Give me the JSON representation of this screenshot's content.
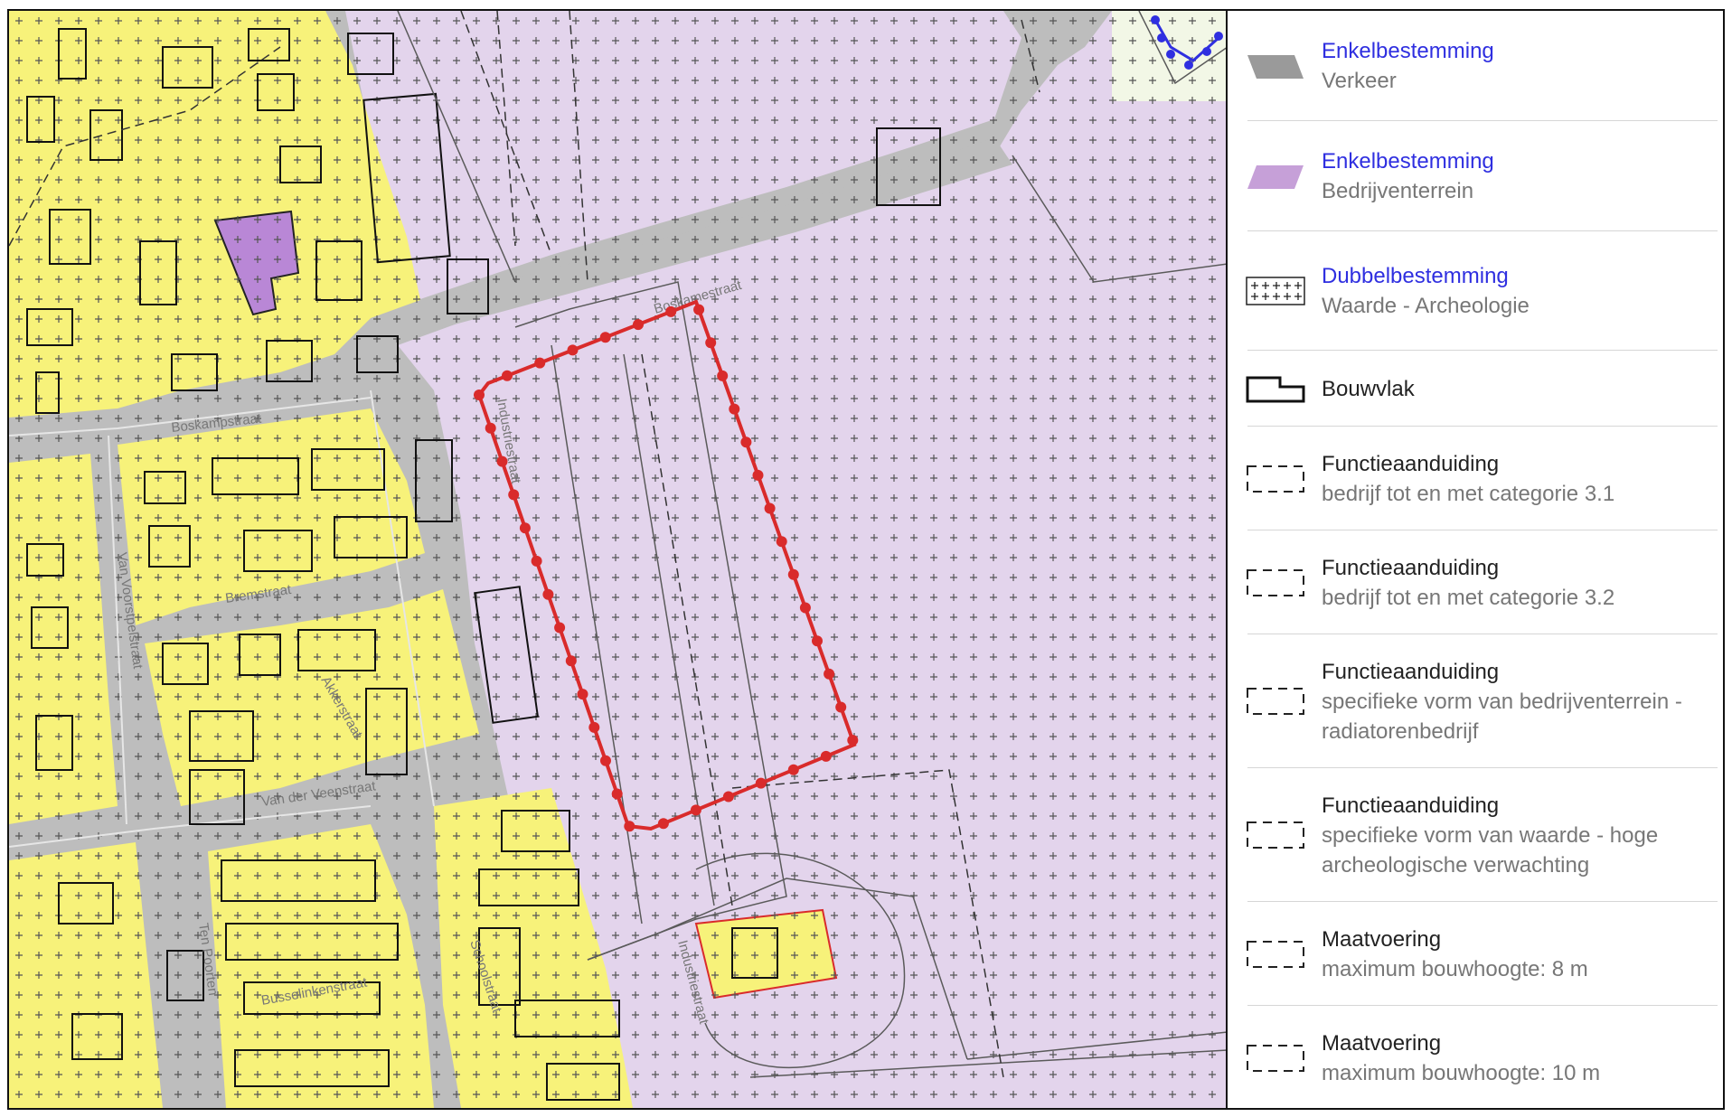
{
  "colors": {
    "verkeer": "#bdbdbd",
    "bedrijventerrein": "#e3d4ec",
    "bedrijventerrein_legend": "#c6a0d8",
    "wonen": "#f7f27a",
    "maatschappelijk": "#b987d6",
    "plangebied": "#d92b2b",
    "bouwvlak": "#111111",
    "kavel_lijn": "#5a5a5a"
  },
  "map": {
    "streets": [
      "Boskamestraat",
      "Boskampstraat",
      "Industriestraat",
      "Van Voorstpelstraat",
      "Bremstraat",
      "Akkerstraat",
      "Van der Veenstraat",
      "Ten Poorten",
      "Busselinkenstraat",
      "Schoolstraat",
      "Industriestraat"
    ]
  },
  "legend": {
    "items": [
      {
        "title": "Enkelbestemming",
        "sub": "Verkeer",
        "symbol": "fill-verkeer-icon",
        "title_color": "blue"
      },
      {
        "title": "Enkelbestemming",
        "sub": "Bedrijventerrein",
        "symbol": "fill-bedrijventerrein-icon",
        "title_color": "blue"
      },
      {
        "title": "Dubbelbestemming",
        "sub": "Waarde - Archeologie",
        "symbol": "crosshatch-icon",
        "title_color": "blue"
      },
      {
        "title": "Bouwvlak",
        "sub": "",
        "symbol": "bouwvlak-icon",
        "title_color": "plain"
      },
      {
        "title": "Functieaanduiding",
        "sub": "bedrijf tot en met categorie 3.1",
        "symbol": "dashed-rect-icon",
        "title_color": "plain"
      },
      {
        "title": "Functieaanduiding",
        "sub": "bedrijf tot en met categorie 3.2",
        "symbol": "dashed-rect-icon",
        "title_color": "plain"
      },
      {
        "title": "Functieaanduiding",
        "sub": "specifieke vorm van bedrijventerrein - radiatorenbedrijf",
        "symbol": "dashed-rect-icon",
        "title_color": "plain"
      },
      {
        "title": "Functieaanduiding",
        "sub": "specifieke vorm van waarde - hoge archeologische verwachting",
        "symbol": "dashed-rect-icon",
        "title_color": "plain"
      },
      {
        "title": "Maatvoering",
        "sub": "maximum bouwhoogte: 8 m",
        "symbol": "dashed-rect-icon",
        "title_color": "plain"
      },
      {
        "title": "Maatvoering",
        "sub": "maximum bouwhoogte: 10 m",
        "symbol": "dashed-rect-icon",
        "title_color": "plain"
      }
    ]
  }
}
